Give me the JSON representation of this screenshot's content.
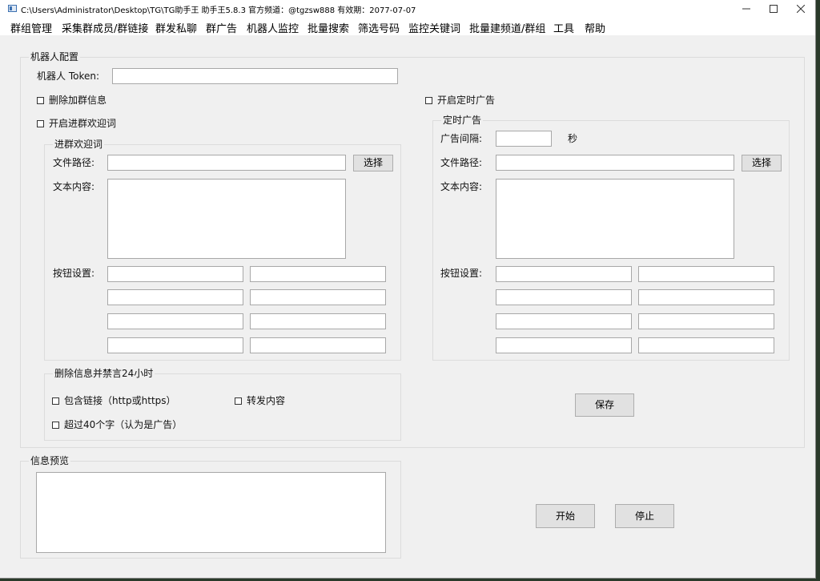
{
  "window": {
    "title": "C:\\Users\\Administrator\\Desktop\\TG\\TG助手王  助手王5.8.3  官方频道：@tgzsw888      有效期：2077-07-07",
    "minimize_icon": "minimize-icon",
    "maximize_icon": "maximize-icon",
    "close_icon": "close-icon"
  },
  "menu": [
    "群组管理",
    "采集群成员/群链接",
    "群发私聊",
    "群广告",
    "机器人监控",
    "批量搜索",
    "筛选号码",
    "监控关键词",
    "批量建频道/群组",
    "工具",
    "帮助"
  ],
  "bot_config": {
    "title": "机器人配置",
    "token_label": "机器人 Token:",
    "token_value": "",
    "delete_join_label": "删除加群信息",
    "welcome_enable_label": "开启进群欢迎词",
    "timed_ad_enable_label": "开启定时广告"
  },
  "welcome": {
    "title": "进群欢迎词",
    "file_path_label": "文件路径:",
    "file_path_value": "",
    "select_label": "选择",
    "text_label": "文本内容:",
    "text_value": "",
    "button_label": "按钮设置:"
  },
  "timed_ad": {
    "title": "定时广告",
    "interval_label": "广告间隔:",
    "interval_value": "",
    "seconds_label": "秒",
    "file_path_label": "文件路径:",
    "file_path_value": "",
    "select_label": "选择",
    "text_label": "文本内容:",
    "text_value": "",
    "button_label": "按钮设置:"
  },
  "delete_ban": {
    "title": "删除信息并禁言24小时",
    "include_links_label": "包含链接（http或https）",
    "forward_label": "转发内容",
    "over40_label": "超过40个字（认为是广告）"
  },
  "save_label": "保存",
  "preview": {
    "title": "信息预览",
    "value": ""
  },
  "start_label": "开始",
  "stop_label": "停止"
}
